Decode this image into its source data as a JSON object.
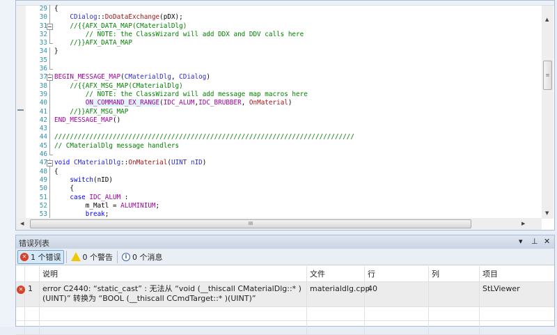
{
  "editor": {
    "lines": [
      {
        "n": "29",
        "fold": "line",
        "segs": [
          [
            "{",
            "p"
          ]
        ]
      },
      {
        "n": "30",
        "fold": "line",
        "segs": [
          [
            "    ",
            "p"
          ],
          [
            "CDialog",
            "t"
          ],
          [
            "::",
            "p"
          ],
          [
            "DoDataExchange",
            "f"
          ],
          [
            "(pDX);",
            "p"
          ]
        ]
      },
      {
        "n": "31",
        "fold": "box",
        "segs": [
          [
            "    ",
            "p"
          ],
          [
            "//{{AFX_DATA_MAP(CMaterialDlg)",
            "c"
          ]
        ]
      },
      {
        "n": "32",
        "fold": "line",
        "segs": [
          [
            "        ",
            "p"
          ],
          [
            "// NOTE: the ClassWizard will add DDX and DDV calls here",
            "c"
          ]
        ]
      },
      {
        "n": "33",
        "fold": "end",
        "segs": [
          [
            "    ",
            "p"
          ],
          [
            "//}}AFX_DATA_MAP",
            "c"
          ]
        ]
      },
      {
        "n": "34",
        "fold": "line",
        "segs": [
          [
            "}",
            "p"
          ]
        ]
      },
      {
        "n": "35",
        "fold": "line",
        "segs": []
      },
      {
        "n": "36",
        "fold": "end",
        "segs": []
      },
      {
        "n": "37",
        "fold": "box",
        "segs": [
          [
            "BEGIN_MESSAGE_MAP",
            "m"
          ],
          [
            "(",
            "p"
          ],
          [
            "CMaterialDlg",
            "t"
          ],
          [
            ", ",
            "p"
          ],
          [
            "CDialog",
            "t"
          ],
          [
            ")",
            "p"
          ]
        ]
      },
      {
        "n": "38",
        "fold": "line",
        "segs": [
          [
            "    ",
            "p"
          ],
          [
            "//{{AFX_MSG_MAP(CMaterialDlg)",
            "c"
          ]
        ]
      },
      {
        "n": "39",
        "fold": "line",
        "segs": [
          [
            "        ",
            "p"
          ],
          [
            "// NOTE: the ClassWizard will add message map macros here",
            "c"
          ]
        ]
      },
      {
        "n": "40",
        "fold": "line",
        "segs": [
          [
            "        ",
            "p"
          ],
          [
            "ON_COMMAND_EX_RANGE",
            "m hl"
          ],
          [
            "(",
            "p"
          ],
          [
            "IDC_ALUM",
            "m"
          ],
          [
            ",",
            "p"
          ],
          [
            "IDC_BRUBBER",
            "m"
          ],
          [
            ", ",
            "p"
          ],
          [
            "OnMaterial",
            "f"
          ],
          [
            ")",
            "p"
          ]
        ]
      },
      {
        "n": "41",
        "fold": "line",
        "segs": [
          [
            "    ",
            "p"
          ],
          [
            "//}}AFX_MSG_MAP",
            "c"
          ]
        ]
      },
      {
        "n": "42",
        "fold": "line",
        "segs": [
          [
            "END_MESSAGE_MAP",
            "m"
          ],
          [
            "()",
            "p"
          ]
        ]
      },
      {
        "n": "43",
        "fold": "line",
        "segs": []
      },
      {
        "n": "44",
        "fold": "line",
        "segs": [
          [
            "/////////////////////////////////////////////////////////////////////////////",
            "c"
          ]
        ]
      },
      {
        "n": "45",
        "fold": "line",
        "segs": [
          [
            "// CMaterialDlg message handlers",
            "c"
          ]
        ]
      },
      {
        "n": "46",
        "fold": "end",
        "segs": []
      },
      {
        "n": "47",
        "fold": "box",
        "segs": [
          [
            "void",
            "k"
          ],
          [
            " ",
            "p"
          ],
          [
            "CMaterialDlg",
            "t"
          ],
          [
            "::",
            "p"
          ],
          [
            "OnMaterial",
            "f"
          ],
          [
            "(",
            "p"
          ],
          [
            "UINT",
            "t"
          ],
          [
            " ",
            "p"
          ],
          [
            "nID",
            "t"
          ],
          [
            ")",
            "p"
          ]
        ]
      },
      {
        "n": "48",
        "fold": "line",
        "segs": [
          [
            "{",
            "p"
          ]
        ]
      },
      {
        "n": "49",
        "fold": "line",
        "segs": [
          [
            "    ",
            "p"
          ],
          [
            "switch",
            "k"
          ],
          [
            "(nID)",
            "p"
          ]
        ]
      },
      {
        "n": "50",
        "fold": "line",
        "segs": [
          [
            "    {",
            "p"
          ]
        ]
      },
      {
        "n": "51",
        "fold": "line",
        "segs": [
          [
            "    ",
            "p"
          ],
          [
            "case",
            "k"
          ],
          [
            " ",
            "p"
          ],
          [
            "IDC_ALUM",
            "m"
          ],
          [
            " :",
            "p"
          ]
        ]
      },
      {
        "n": "52",
        "fold": "line",
        "segs": [
          [
            "        m_Matl = ",
            "p"
          ],
          [
            "ALUMINIUM",
            "m"
          ],
          [
            ";",
            "p"
          ]
        ]
      },
      {
        "n": "53",
        "fold": "line",
        "segs": [
          [
            "        ",
            "p"
          ],
          [
            "break",
            "k"
          ],
          [
            ";",
            "p"
          ]
        ]
      }
    ]
  },
  "error_list": {
    "title": "错误列表",
    "controls": {
      "dropdown": "▾",
      "pin": "⊥",
      "close": "✕"
    },
    "filters": {
      "errors": "1 个错误",
      "warnings": "0 个警告",
      "messages": "0 个消息"
    },
    "columns": [
      "",
      "",
      "说明",
      "文件",
      "行",
      "列",
      "项目"
    ],
    "rows": [
      {
        "index": "1",
        "description": "error C2440: “static_cast” : 无法从 “void (__thiscall CMaterialDlg::* )(UINT)” 转换为 “BOOL (__thiscall CCmdTarget::* )(UINT)”",
        "file": "materialdlg.cpp",
        "line": "40",
        "column": "",
        "project": "StLViewer"
      }
    ]
  }
}
